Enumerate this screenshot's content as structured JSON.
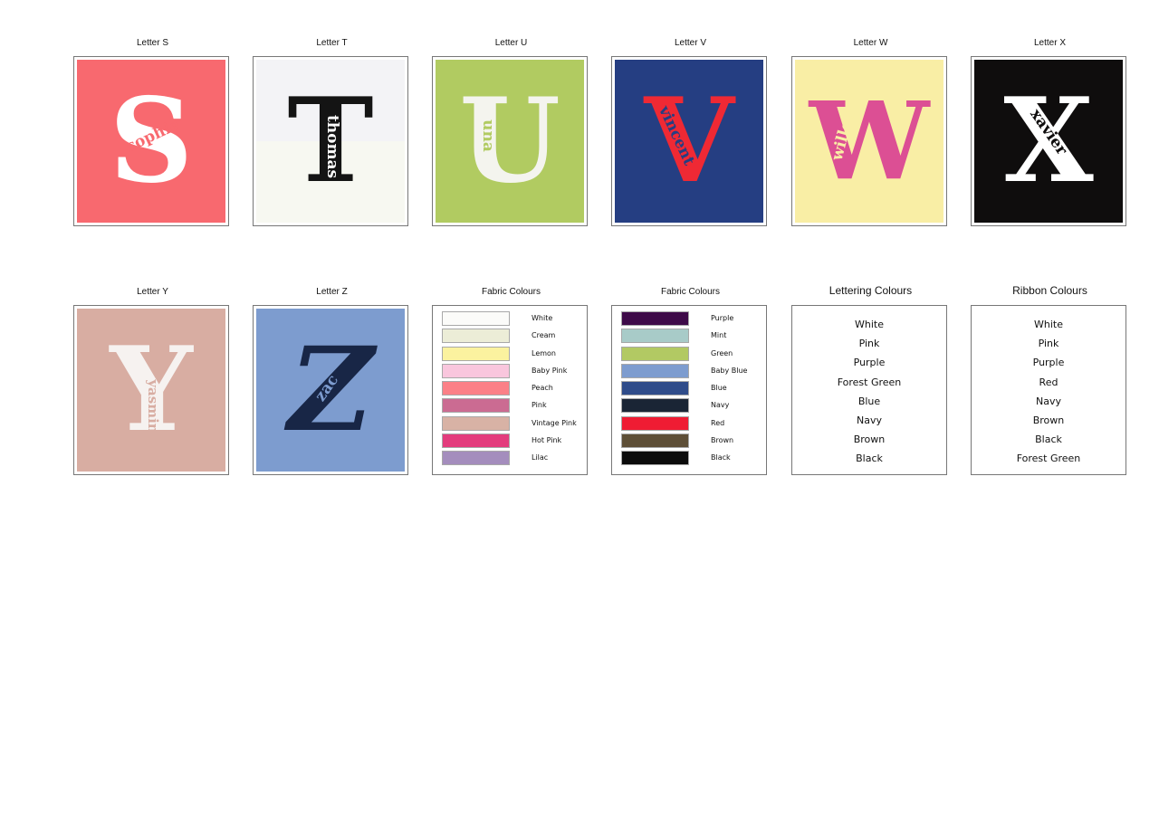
{
  "letters": {
    "s": {
      "title": "Letter S",
      "letter": "S",
      "name": "sophie",
      "bg": "#f8696f",
      "letter_color": "#ffffff",
      "name_color": "#f8696f"
    },
    "t": {
      "title": "Letter T",
      "letter": "T",
      "name": "thomas",
      "bg": "#f3f3f3",
      "letter_color": "#141414",
      "name_color": "#ffffff"
    },
    "u": {
      "title": "Letter U",
      "letter": "U",
      "name": "una",
      "bg": "#b1cb61",
      "letter_color": "#f4f4ee",
      "name_color": "#b1cb61"
    },
    "v": {
      "title": "Letter V",
      "letter": "V",
      "name": "vincent",
      "bg": "#253e82",
      "letter_color": "#ef2934",
      "name_color": "#253e82"
    },
    "w": {
      "title": "Letter W",
      "letter": "W",
      "name": "willow",
      "bg": "#f9eea5",
      "letter_color": "#dc4f94",
      "name_color": "#f9eea5"
    },
    "x": {
      "title": "Letter X",
      "letter": "X",
      "name": "xavier",
      "bg": "#0f0d0d",
      "letter_color": "#ffffff",
      "name_color": "#0f0d0d"
    },
    "y": {
      "title": "Letter Y",
      "letter": "Y",
      "name": "yasmin",
      "bg": "#d8ada2",
      "letter_color": "#f6f2f0",
      "name_color": "#d8ada2"
    },
    "z": {
      "title": "Letter Z",
      "letter": "Z",
      "name": "zac",
      "bg": "#7d9ccf",
      "letter_color": "#182646",
      "name_color": "#7d9ccf"
    }
  },
  "fabric_colours_1": {
    "title": "Fabric Colours",
    "items": [
      {
        "label": "White",
        "color": "#fbfbf9"
      },
      {
        "label": "Cream",
        "color": "#ecedd7"
      },
      {
        "label": "Lemon",
        "color": "#fbf29f"
      },
      {
        "label": "Baby Pink",
        "color": "#f9c6dd"
      },
      {
        "label": "Peach",
        "color": "#fb8087"
      },
      {
        "label": "Pink",
        "color": "#cb6b92"
      },
      {
        "label": "Vintage Pink",
        "color": "#d8b2a5"
      },
      {
        "label": "Hot Pink",
        "color": "#e33c7d"
      },
      {
        "label": "Lilac",
        "color": "#a48dbd"
      }
    ]
  },
  "fabric_colours_2": {
    "title": "Fabric Colours",
    "items": [
      {
        "label": "Purple",
        "color": "#3e0a48"
      },
      {
        "label": "Mint",
        "color": "#a8cbc8"
      },
      {
        "label": "Green",
        "color": "#b2c963"
      },
      {
        "label": "Baby Blue",
        "color": "#7d9ccf"
      },
      {
        "label": "Blue",
        "color": "#2f4c8a"
      },
      {
        "label": "Navy",
        "color": "#1a2535"
      },
      {
        "label": "Red",
        "color": "#ef1c33"
      },
      {
        "label": "Brown",
        "color": "#5e4f37"
      },
      {
        "label": "Black",
        "color": "#0b0b0b"
      }
    ]
  },
  "lettering_colours": {
    "title": "Lettering Colours",
    "items": [
      "White",
      "Pink",
      "Purple",
      "Forest Green",
      "Blue",
      "Navy",
      "Brown",
      "Black"
    ]
  },
  "ribbon_colours": {
    "title": "Ribbon Colours",
    "items": [
      "White",
      "Pink",
      "Purple",
      "Red",
      "Navy",
      "Brown",
      "Black",
      "Forest Green"
    ]
  }
}
